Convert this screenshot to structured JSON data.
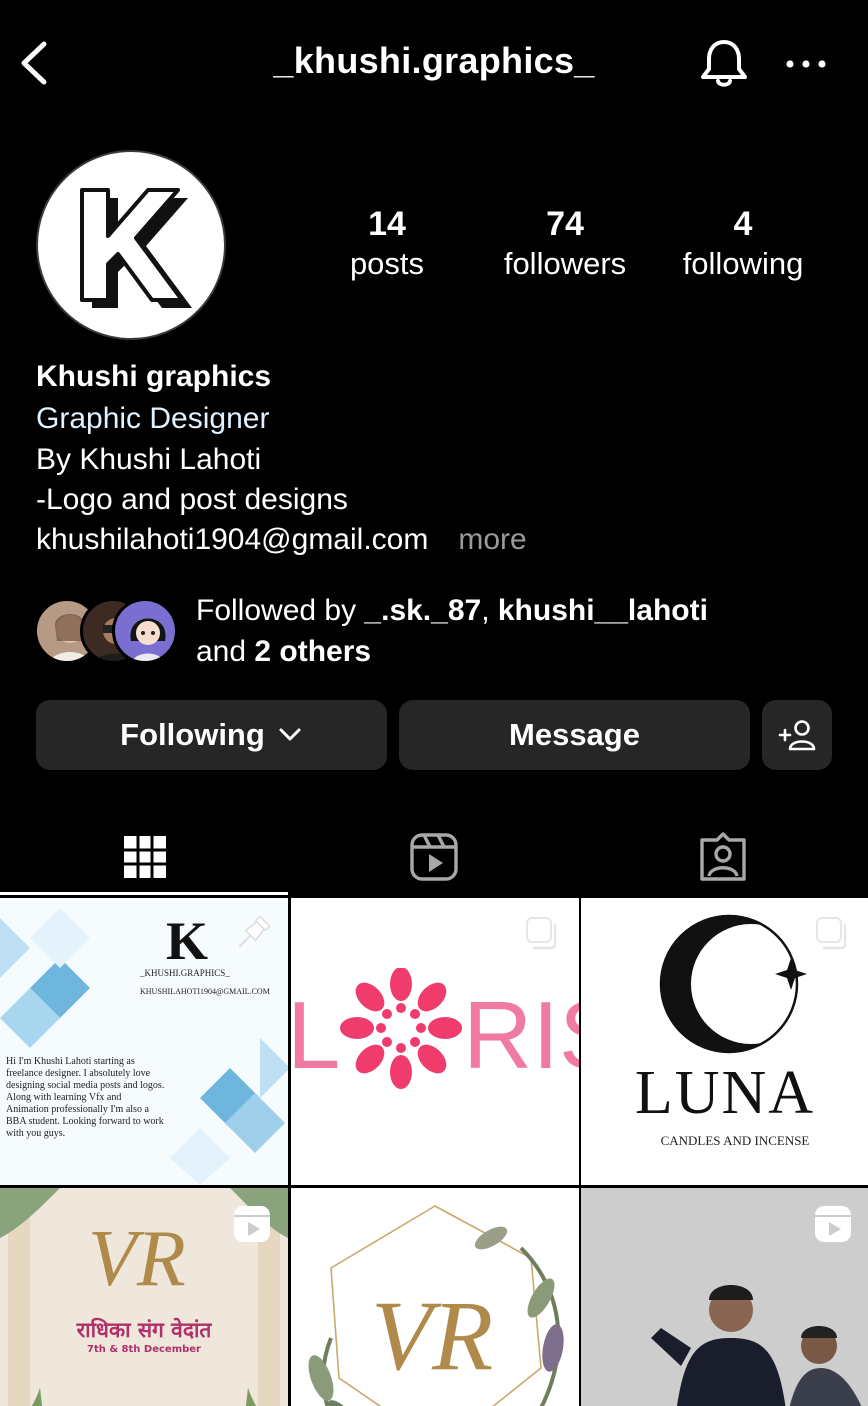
{
  "header": {
    "username": "_khushi.graphics_",
    "back_icon": "chevron-left-icon",
    "bell_icon": "bell-icon",
    "more_icon": "more-horizontal-icon"
  },
  "stats": [
    {
      "value": "14",
      "label": "posts"
    },
    {
      "value": "74",
      "label": "followers"
    },
    {
      "value": "4",
      "label": "following"
    }
  ],
  "profile": {
    "avatar_letter": "K",
    "display_name": "Khushi graphics",
    "category": "Graphic Designer",
    "bio_lines": [
      "By Khushi Lahoti",
      "-Logo and post designs"
    ],
    "email": "khushilahoti1904@gmail.com",
    "more_label": "more"
  },
  "followed_by": {
    "prefix": "Followed by ",
    "user1": "_.sk._87",
    "separator": ", ",
    "user2": "khushi__lahoti",
    "and_text": "and ",
    "others": "2 others"
  },
  "actions": {
    "following_label": "Following",
    "message_label": "Message",
    "add_user_icon": "add-user-icon"
  },
  "tabs": [
    {
      "icon": "grid-icon",
      "active": true
    },
    {
      "icon": "reels-icon",
      "active": false
    },
    {
      "icon": "tagged-icon",
      "active": false
    }
  ],
  "posts": {
    "post1": {
      "letter": "K",
      "handle": "_KHUSHI.GRAPHICS_",
      "email": "KHUSHILAHOTI1904@GMAIL.COM",
      "intro": "Hi I'm Khushi Lahoti starting as freelance designer. I absolutely love designing social media posts and logos. Along with learning Vfx and Animation professionally I'm also a BBA student. Looking forward to work with you guys.",
      "badge": "pin-icon"
    },
    "post2": {
      "text_left": "L",
      "text_right": "RIS",
      "badge": "multiple-posts-icon"
    },
    "post3": {
      "brand": "LUNA",
      "subtitle": "CANDLES AND INCENSE",
      "badge": "multiple-posts-icon"
    },
    "post4": {
      "monogram": "VR",
      "hindi": "राधिका संग वेदांत",
      "date": "7th & 8th December",
      "badge": "reel-icon"
    },
    "post5": {
      "monogram": "VR"
    },
    "post6": {
      "badge": "reel-icon"
    }
  },
  "colors": {
    "background": "#000000",
    "button": "#262626",
    "category": "#e0f1ff",
    "muted": "#9a9a9a",
    "loris_pink": "#f0457a"
  }
}
